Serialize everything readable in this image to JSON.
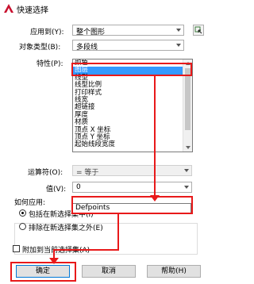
{
  "window": {
    "title": "快速选择"
  },
  "apply_to": {
    "label": "应用到(Y):",
    "value": "整个图形"
  },
  "object_type": {
    "label": "对象类型(B):",
    "value": "多段线"
  },
  "properties": {
    "label": "特性(P):",
    "items": [
      "颜色",
      "图层",
      "线型",
      "线型比例",
      "打印样式",
      "线宽",
      "超链接",
      "厚度",
      "材质",
      "顶点 X 坐标",
      "顶点 Y 坐标",
      "起始线段宽度"
    ],
    "selected_index": 1
  },
  "operator": {
    "label": "运算符(O):",
    "value": "= 等于"
  },
  "value": {
    "label": "值(V):",
    "value": "0",
    "options": [
      "0",
      "Defpoints"
    ]
  },
  "how_to_apply": {
    "label": "如何应用:",
    "include": "包括在新选择集中(I)",
    "exclude": "排除在新选择集之外(E)"
  },
  "append": {
    "label": "附加到当前选择集(A)"
  },
  "buttons": {
    "ok": "确定",
    "cancel": "取消",
    "help": "帮助(H)"
  },
  "colors": {
    "annotation": "#e8191a",
    "selection": "#3399ff"
  }
}
